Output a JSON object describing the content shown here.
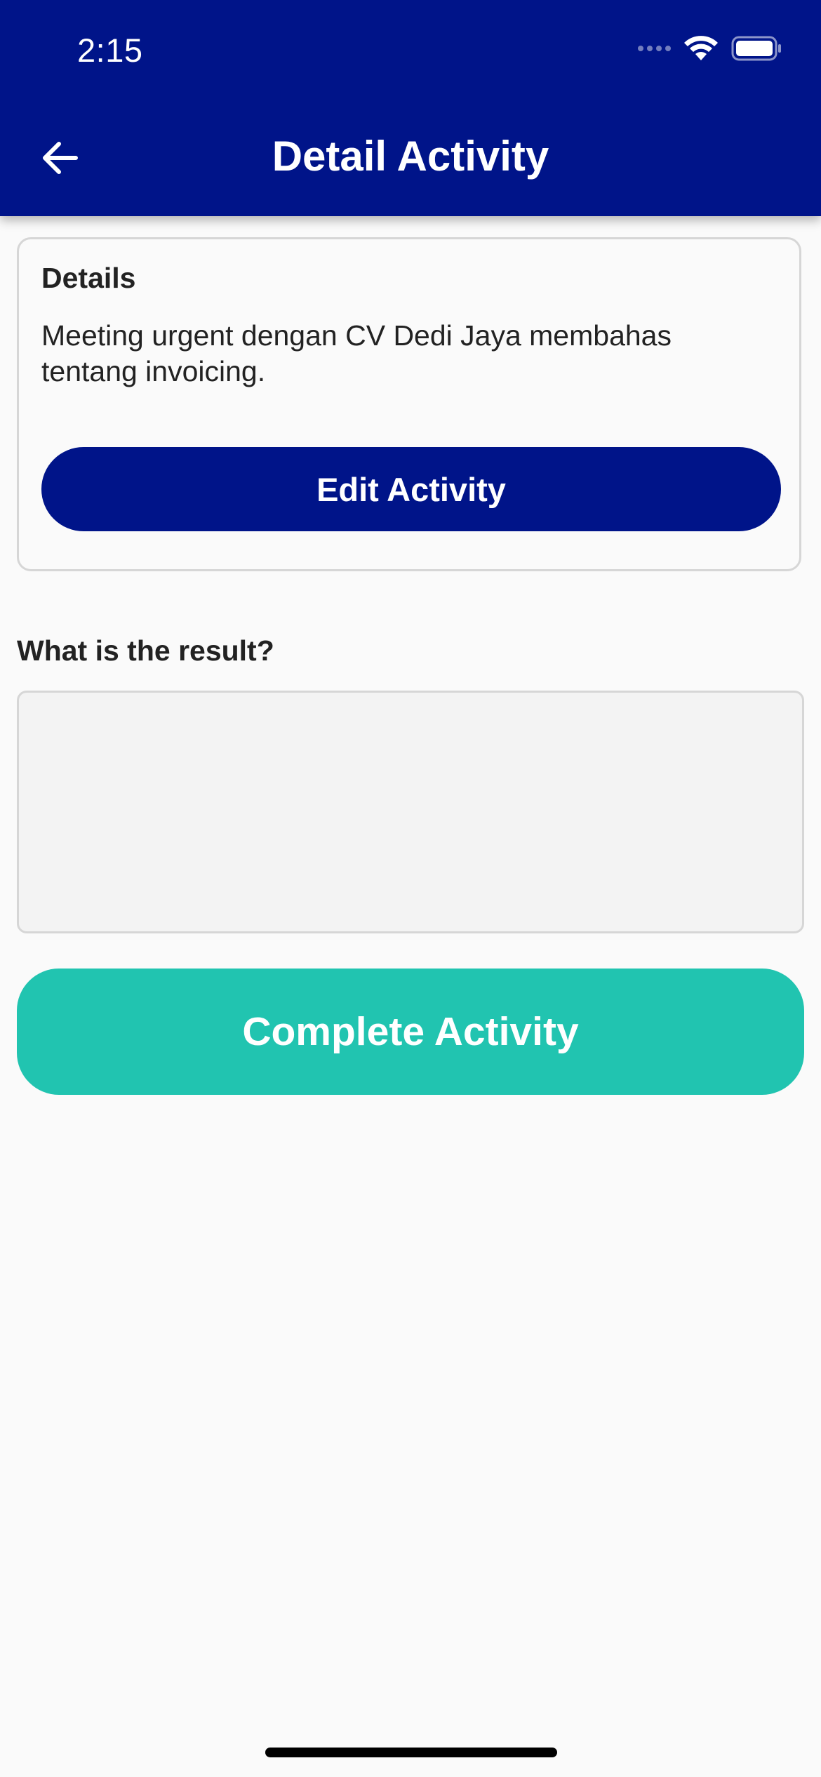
{
  "status_bar": {
    "time": "2:15"
  },
  "app_bar": {
    "title": "Detail Activity",
    "back_icon": "arrow-left-icon",
    "background_color": "#001489"
  },
  "details_card": {
    "heading": "Details",
    "description": "Meeting urgent dengan CV Dedi Jaya membahas tentang invoicing.",
    "edit_button_label": "Edit Activity"
  },
  "result_section": {
    "label": "What is the result?",
    "input_value": ""
  },
  "complete_button": {
    "label": "Complete Activity",
    "color": "#21c4b0"
  }
}
